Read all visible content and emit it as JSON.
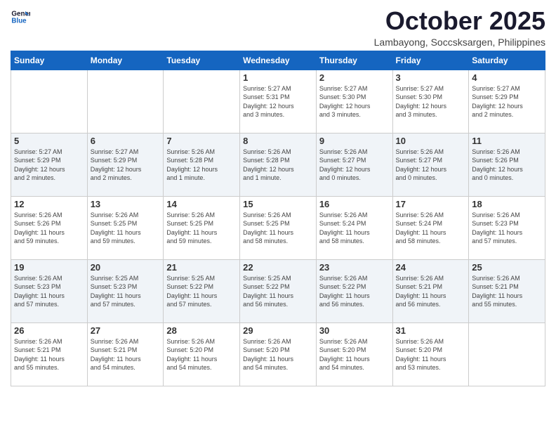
{
  "header": {
    "logo_line1": "General",
    "logo_line2": "Blue",
    "month_title": "October 2025",
    "subtitle": "Lambayong, Soccsksargen, Philippines"
  },
  "weekdays": [
    "Sunday",
    "Monday",
    "Tuesday",
    "Wednesday",
    "Thursday",
    "Friday",
    "Saturday"
  ],
  "weeks": [
    [
      {
        "day": "",
        "info": ""
      },
      {
        "day": "",
        "info": ""
      },
      {
        "day": "",
        "info": ""
      },
      {
        "day": "1",
        "info": "Sunrise: 5:27 AM\nSunset: 5:31 PM\nDaylight: 12 hours\nand 3 minutes."
      },
      {
        "day": "2",
        "info": "Sunrise: 5:27 AM\nSunset: 5:30 PM\nDaylight: 12 hours\nand 3 minutes."
      },
      {
        "day": "3",
        "info": "Sunrise: 5:27 AM\nSunset: 5:30 PM\nDaylight: 12 hours\nand 3 minutes."
      },
      {
        "day": "4",
        "info": "Sunrise: 5:27 AM\nSunset: 5:29 PM\nDaylight: 12 hours\nand 2 minutes."
      }
    ],
    [
      {
        "day": "5",
        "info": "Sunrise: 5:27 AM\nSunset: 5:29 PM\nDaylight: 12 hours\nand 2 minutes."
      },
      {
        "day": "6",
        "info": "Sunrise: 5:27 AM\nSunset: 5:29 PM\nDaylight: 12 hours\nand 2 minutes."
      },
      {
        "day": "7",
        "info": "Sunrise: 5:26 AM\nSunset: 5:28 PM\nDaylight: 12 hours\nand 1 minute."
      },
      {
        "day": "8",
        "info": "Sunrise: 5:26 AM\nSunset: 5:28 PM\nDaylight: 12 hours\nand 1 minute."
      },
      {
        "day": "9",
        "info": "Sunrise: 5:26 AM\nSunset: 5:27 PM\nDaylight: 12 hours\nand 0 minutes."
      },
      {
        "day": "10",
        "info": "Sunrise: 5:26 AM\nSunset: 5:27 PM\nDaylight: 12 hours\nand 0 minutes."
      },
      {
        "day": "11",
        "info": "Sunrise: 5:26 AM\nSunset: 5:26 PM\nDaylight: 12 hours\nand 0 minutes."
      }
    ],
    [
      {
        "day": "12",
        "info": "Sunrise: 5:26 AM\nSunset: 5:26 PM\nDaylight: 11 hours\nand 59 minutes."
      },
      {
        "day": "13",
        "info": "Sunrise: 5:26 AM\nSunset: 5:25 PM\nDaylight: 11 hours\nand 59 minutes."
      },
      {
        "day": "14",
        "info": "Sunrise: 5:26 AM\nSunset: 5:25 PM\nDaylight: 11 hours\nand 59 minutes."
      },
      {
        "day": "15",
        "info": "Sunrise: 5:26 AM\nSunset: 5:25 PM\nDaylight: 11 hours\nand 58 minutes."
      },
      {
        "day": "16",
        "info": "Sunrise: 5:26 AM\nSunset: 5:24 PM\nDaylight: 11 hours\nand 58 minutes."
      },
      {
        "day": "17",
        "info": "Sunrise: 5:26 AM\nSunset: 5:24 PM\nDaylight: 11 hours\nand 58 minutes."
      },
      {
        "day": "18",
        "info": "Sunrise: 5:26 AM\nSunset: 5:23 PM\nDaylight: 11 hours\nand 57 minutes."
      }
    ],
    [
      {
        "day": "19",
        "info": "Sunrise: 5:26 AM\nSunset: 5:23 PM\nDaylight: 11 hours\nand 57 minutes."
      },
      {
        "day": "20",
        "info": "Sunrise: 5:25 AM\nSunset: 5:23 PM\nDaylight: 11 hours\nand 57 minutes."
      },
      {
        "day": "21",
        "info": "Sunrise: 5:25 AM\nSunset: 5:22 PM\nDaylight: 11 hours\nand 57 minutes."
      },
      {
        "day": "22",
        "info": "Sunrise: 5:25 AM\nSunset: 5:22 PM\nDaylight: 11 hours\nand 56 minutes."
      },
      {
        "day": "23",
        "info": "Sunrise: 5:26 AM\nSunset: 5:22 PM\nDaylight: 11 hours\nand 56 minutes."
      },
      {
        "day": "24",
        "info": "Sunrise: 5:26 AM\nSunset: 5:21 PM\nDaylight: 11 hours\nand 56 minutes."
      },
      {
        "day": "25",
        "info": "Sunrise: 5:26 AM\nSunset: 5:21 PM\nDaylight: 11 hours\nand 55 minutes."
      }
    ],
    [
      {
        "day": "26",
        "info": "Sunrise: 5:26 AM\nSunset: 5:21 PM\nDaylight: 11 hours\nand 55 minutes."
      },
      {
        "day": "27",
        "info": "Sunrise: 5:26 AM\nSunset: 5:21 PM\nDaylight: 11 hours\nand 54 minutes."
      },
      {
        "day": "28",
        "info": "Sunrise: 5:26 AM\nSunset: 5:20 PM\nDaylight: 11 hours\nand 54 minutes."
      },
      {
        "day": "29",
        "info": "Sunrise: 5:26 AM\nSunset: 5:20 PM\nDaylight: 11 hours\nand 54 minutes."
      },
      {
        "day": "30",
        "info": "Sunrise: 5:26 AM\nSunset: 5:20 PM\nDaylight: 11 hours\nand 54 minutes."
      },
      {
        "day": "31",
        "info": "Sunrise: 5:26 AM\nSunset: 5:20 PM\nDaylight: 11 hours\nand 53 minutes."
      },
      {
        "day": "",
        "info": ""
      }
    ]
  ]
}
